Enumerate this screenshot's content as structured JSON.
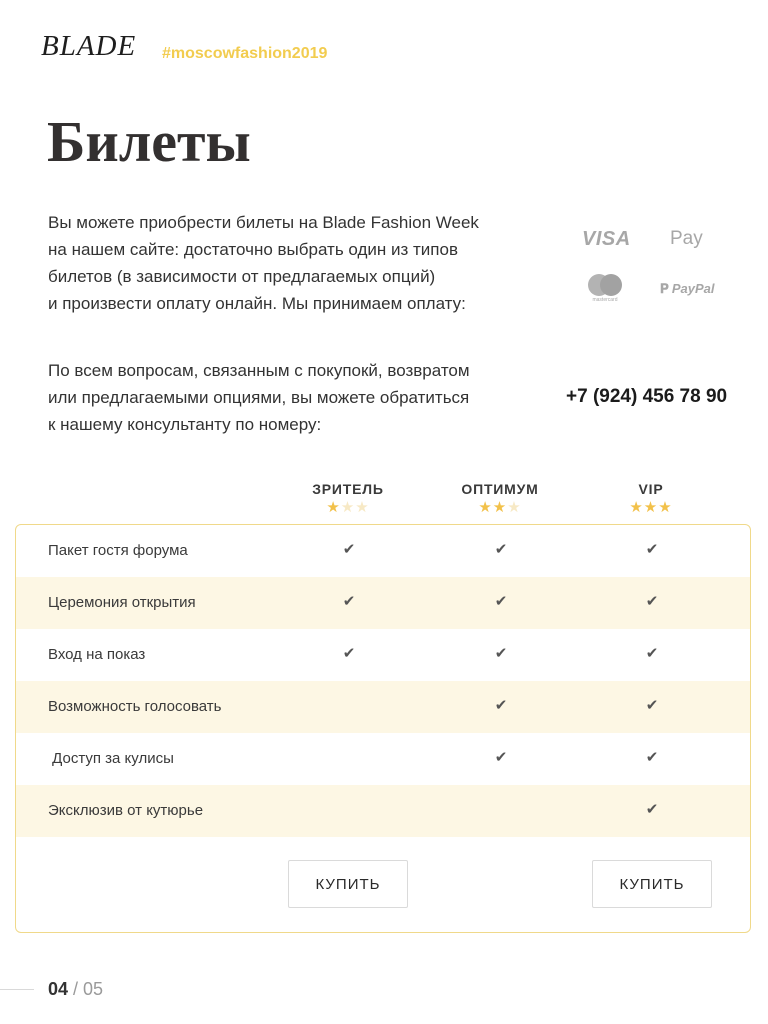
{
  "header": {
    "logo": "BLADE",
    "hashtag": "#moscowfashion2019"
  },
  "page_title": "Билеты",
  "intro": {
    "lines": [
      "Вы можете приобрести билеты на Blade Fashion Week",
      "на нашем сайте: достаточно выбрать один из типов",
      "билетов (в зависимости от предлагаемых опций)",
      "и произвести оплату онлайн. Мы принимаем оплату:"
    ]
  },
  "payments": {
    "visa": "VISA",
    "apple_glyph": "",
    "apple_pay": "Pay",
    "mastercard": "mastercard",
    "paypal": "PayPal"
  },
  "contact": {
    "lines": [
      "По всем вопросам, связанным с покупокй, возвратом",
      "или предлагаемыми опциями, вы можете обратиться",
      "к нашему консультанту по номеру:"
    ],
    "phone": "+7 (924) 456 78 90"
  },
  "tiers": [
    {
      "name": "ЗРИТЕЛЬ",
      "stars": 1,
      "max_stars": 3
    },
    {
      "name": "ОПТИМУМ",
      "stars": 2,
      "max_stars": 3
    },
    {
      "name": "VIP",
      "stars": 3,
      "max_stars": 3
    }
  ],
  "features": [
    {
      "label": "Пакет гостя форума",
      "included": [
        true,
        true,
        true
      ]
    },
    {
      "label": "Церемония открытия",
      "included": [
        true,
        true,
        true
      ]
    },
    {
      "label": "Вход на показ",
      "included": [
        true,
        true,
        true
      ]
    },
    {
      "label": "Возможность голосовать",
      "included": [
        false,
        true,
        true
      ]
    },
    {
      "label": " Доступ за кулисы",
      "included": [
        false,
        true,
        true
      ]
    },
    {
      "label": "Эксклюзив от кутюрье",
      "included": [
        false,
        false,
        true
      ]
    }
  ],
  "buttons": {
    "buy_1": "КУПИТЬ",
    "buy_3": "КУПИТЬ"
  },
  "pagination": {
    "current": "04",
    "separator": " / ",
    "total": "05"
  },
  "icons": {
    "check": "check-icon",
    "star": "star-icon"
  },
  "colors": {
    "accent": "#f2cc4f",
    "row_alt": "#fdf7e4",
    "border": "#f0d98a"
  }
}
